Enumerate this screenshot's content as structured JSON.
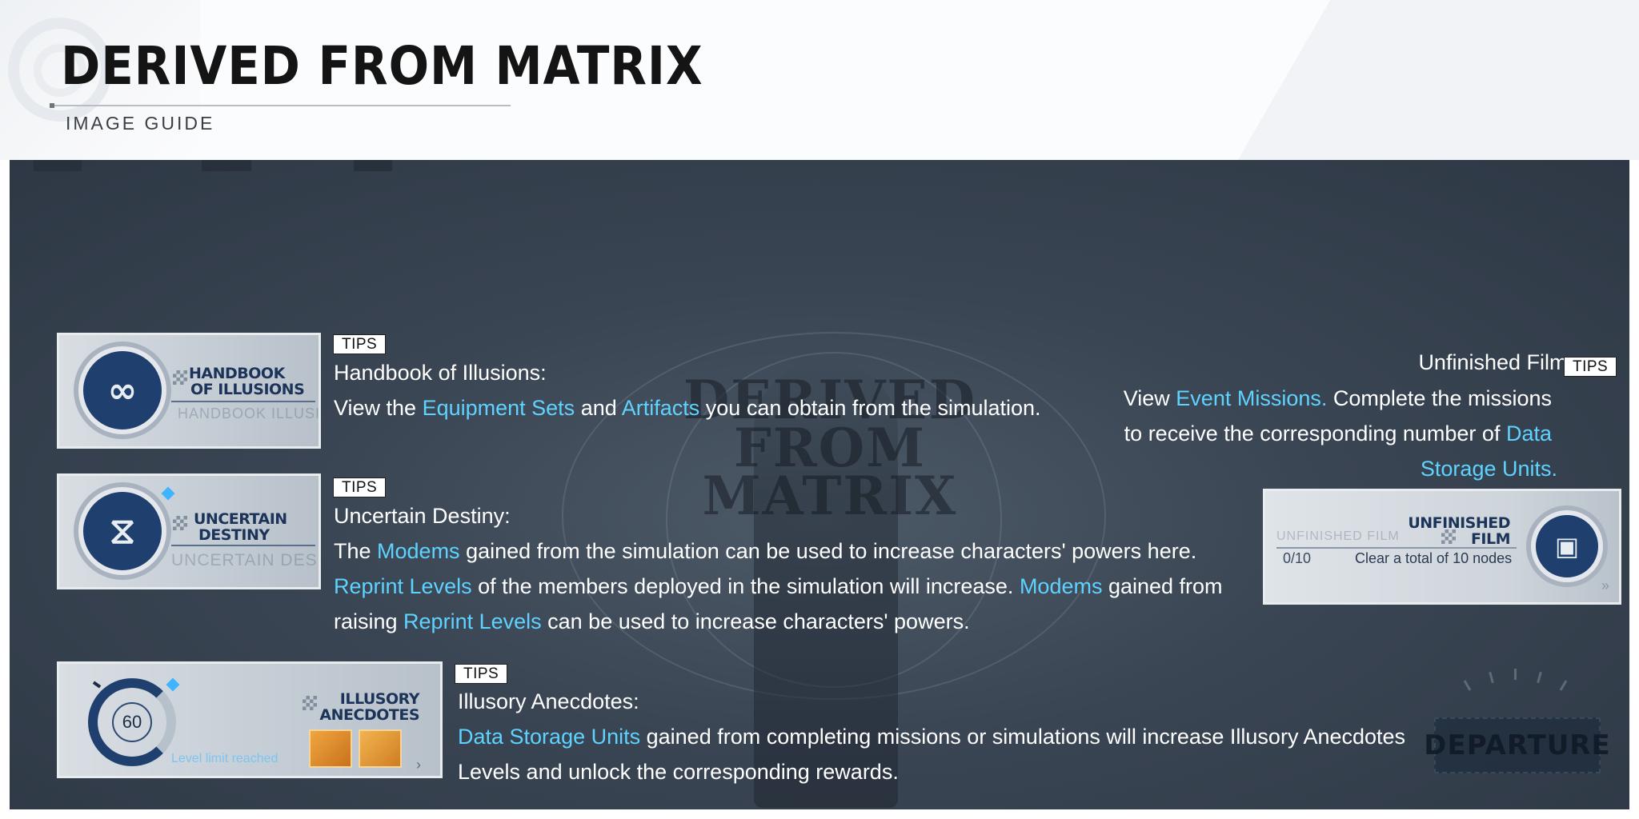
{
  "header": {
    "title": "DERIVED FROM MATRIX",
    "subtitle": "IMAGE GUIDE"
  },
  "background": {
    "logo_line1": "DERIVED",
    "logo_line2": "FROM MATRIX",
    "departure_stamp": "DEPARTURE"
  },
  "tips_label": "TIPS",
  "handbook": {
    "card_title_1": "HANDBOOK",
    "card_title_2": "OF ILLUSIONS",
    "card_ghost": "HANDBOOK ILLUSIC",
    "heading": "Handbook of Illusions:",
    "line1": [
      "View the ",
      "Equipment Sets",
      " and ",
      "Artifacts",
      " you can obtain from the simulation."
    ]
  },
  "uncertain": {
    "card_title_1": "UNCERTAIN",
    "card_title_2": "DESTINY",
    "card_ghost": "UNCERTAIN DES",
    "heading": "Uncertain Destiny:",
    "line1": [
      "The ",
      "Modems",
      " gained from the simulation can be used to increase characters' powers here."
    ],
    "line2": [
      "Reprint Levels",
      " of the members deployed in the simulation will increase. ",
      "Modems",
      " gained from"
    ],
    "line3": [
      "raising ",
      "Reprint Levels",
      " can be used to increase characters' powers."
    ]
  },
  "illusory": {
    "card_title_1": "ILLUSORY",
    "card_title_2": "ANECDOTES",
    "level": "60",
    "card_footer": "Level limit reached",
    "heading": "Illusory Anecdotes:",
    "line1": [
      "Data Storage Units",
      " gained from completing missions or simulations will increase Illusory Anecdotes"
    ],
    "line2": [
      "Levels and unlock the corresponding rewards."
    ]
  },
  "unfinished": {
    "card_title_1": "UNFINISHED",
    "card_title_2": "FILM",
    "card_ghost": "UNFINISHED FILM",
    "progress": "0/10",
    "card_desc": "Clear a total of 10 nodes",
    "heading": "Unfinished Film:",
    "line1": [
      "View ",
      "Event Missions.",
      " Complete the missions"
    ],
    "line2": [
      "to receive the corresponding number of ",
      "Data"
    ],
    "line3": [
      "Storage Units."
    ]
  },
  "colors": {
    "highlight": "#5ed3ff",
    "text": "#ffffff",
    "card_emblem": "#1f3f6e"
  }
}
